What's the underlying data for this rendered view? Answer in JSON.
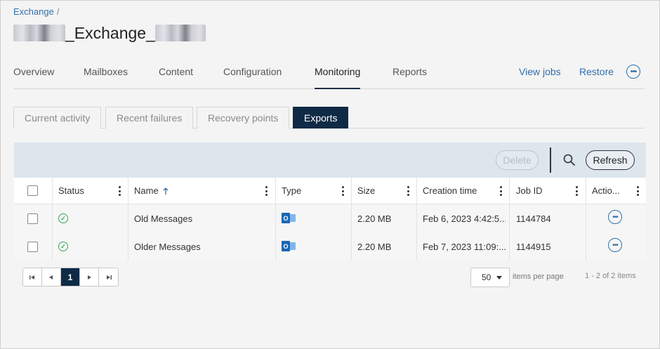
{
  "breadcrumb": {
    "link": "Exchange",
    "separator": "/"
  },
  "title": {
    "text": "_Exchange_"
  },
  "tabs": [
    {
      "label": "Overview"
    },
    {
      "label": "Mailboxes"
    },
    {
      "label": "Content"
    },
    {
      "label": "Configuration"
    },
    {
      "label": "Monitoring",
      "active": true
    },
    {
      "label": "Reports"
    }
  ],
  "top_actions": {
    "view_jobs": "View jobs",
    "restore": "Restore",
    "more_icon": "more-horizontal-icon"
  },
  "subtabs": [
    {
      "label": "Current activity"
    },
    {
      "label": "Recent failures"
    },
    {
      "label": "Recovery points"
    },
    {
      "label": "Exports",
      "active": true
    }
  ],
  "toolbar": {
    "delete_label": "Delete",
    "refresh_label": "Refresh",
    "search_icon": "search-icon"
  },
  "table": {
    "columns": [
      "Status",
      "Name",
      "Type",
      "Size",
      "Creation time",
      "Job ID",
      "Actio..."
    ],
    "sort": {
      "column": "Name",
      "direction": "ascending"
    },
    "rows": [
      {
        "status": "success",
        "name": "Old Messages",
        "type": "outlook-icon",
        "size": "2.20 MB",
        "creation_time": "Feb 6, 2023 4:42:5...",
        "job_id": "1144784"
      },
      {
        "status": "success",
        "name": "Older Messages",
        "type": "outlook-icon",
        "size": "2.20 MB",
        "creation_time": "Feb 7, 2023 11:09:...",
        "job_id": "1144915"
      }
    ]
  },
  "pagination": {
    "current_page": "1",
    "per_page": "50",
    "per_page_label": "items per page",
    "summary": "1 - 2 of 2 items"
  },
  "colors": {
    "accent": "#2f6fad",
    "active_dark": "#0e2a45",
    "toolbar_bg": "#dde5ed",
    "success": "#3aa655",
    "outlook_blue": "#1b66b5"
  }
}
